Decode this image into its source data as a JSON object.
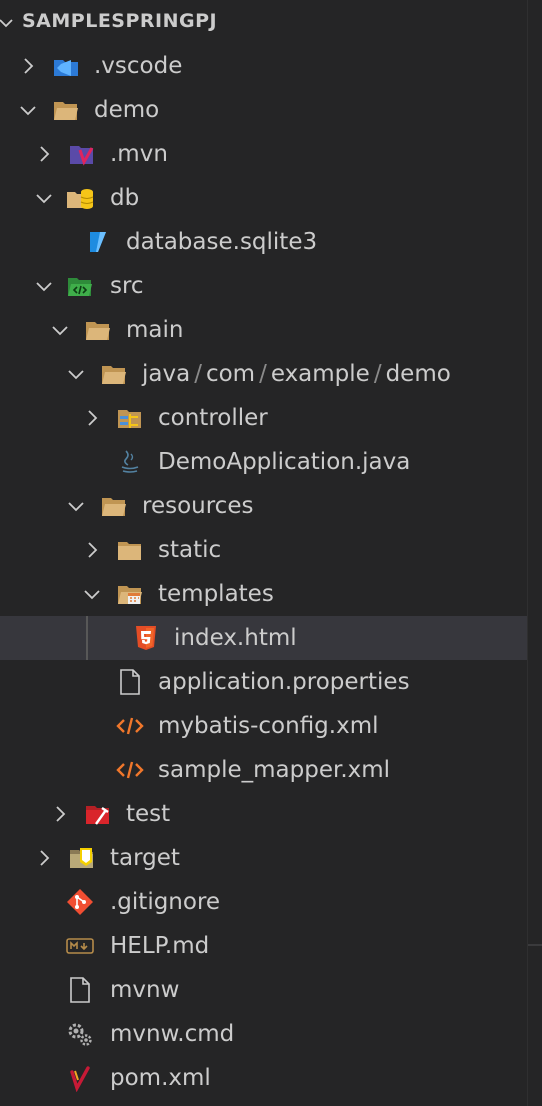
{
  "header": {
    "title": "SAMPLESPRINGPJ"
  },
  "tree": [
    {
      "label": ".vscode",
      "icon": "vscode-folder-icon",
      "expanded": false
    },
    {
      "label": "demo",
      "icon": "folder-open-icon",
      "expanded": true
    },
    {
      "label": ".mvn",
      "icon": "maven-folder-icon",
      "expanded": false
    },
    {
      "label": "db",
      "icon": "database-folder-icon",
      "expanded": true
    },
    {
      "label": "database.sqlite3",
      "icon": "sqlite-file-icon"
    },
    {
      "label": "src",
      "icon": "src-folder-icon",
      "expanded": true
    },
    {
      "label": "main",
      "icon": "folder-open-icon",
      "expanded": true
    },
    {
      "label": "java/com/example/demo",
      "segments": [
        "java",
        "com",
        "example",
        "demo"
      ],
      "icon": "folder-open-icon",
      "expanded": true
    },
    {
      "label": "controller",
      "icon": "controller-folder-icon",
      "expanded": false
    },
    {
      "label": "DemoApplication.java",
      "icon": "java-file-icon"
    },
    {
      "label": "resources",
      "icon": "folder-open-icon",
      "expanded": true
    },
    {
      "label": "static",
      "icon": "folder-closed-icon",
      "expanded": false
    },
    {
      "label": "templates",
      "icon": "templates-folder-icon",
      "expanded": true
    },
    {
      "label": "index.html",
      "icon": "html5-file-icon",
      "selected": true
    },
    {
      "label": "application.properties",
      "icon": "properties-file-icon"
    },
    {
      "label": "mybatis-config.xml",
      "icon": "xml-file-icon"
    },
    {
      "label": "sample_mapper.xml",
      "icon": "xml-file-icon"
    },
    {
      "label": "test",
      "icon": "test-folder-icon",
      "expanded": false
    },
    {
      "label": "target",
      "icon": "target-folder-icon",
      "expanded": false
    },
    {
      "label": ".gitignore",
      "icon": "git-file-icon"
    },
    {
      "label": "HELP.md",
      "icon": "markdown-file-icon"
    },
    {
      "label": "mvnw",
      "icon": "generic-file-icon"
    },
    {
      "label": "mvnw.cmd",
      "icon": "gear-file-icon"
    },
    {
      "label": "pom.xml",
      "icon": "maven-file-icon"
    }
  ],
  "colors": {
    "background": "#252526",
    "selection": "#37373d",
    "text": "#cccccc",
    "folder": "#dcb67a",
    "xml": "#f0772b",
    "html": "#e44d26",
    "git": "#f14e32",
    "maven": "#c71a36"
  }
}
